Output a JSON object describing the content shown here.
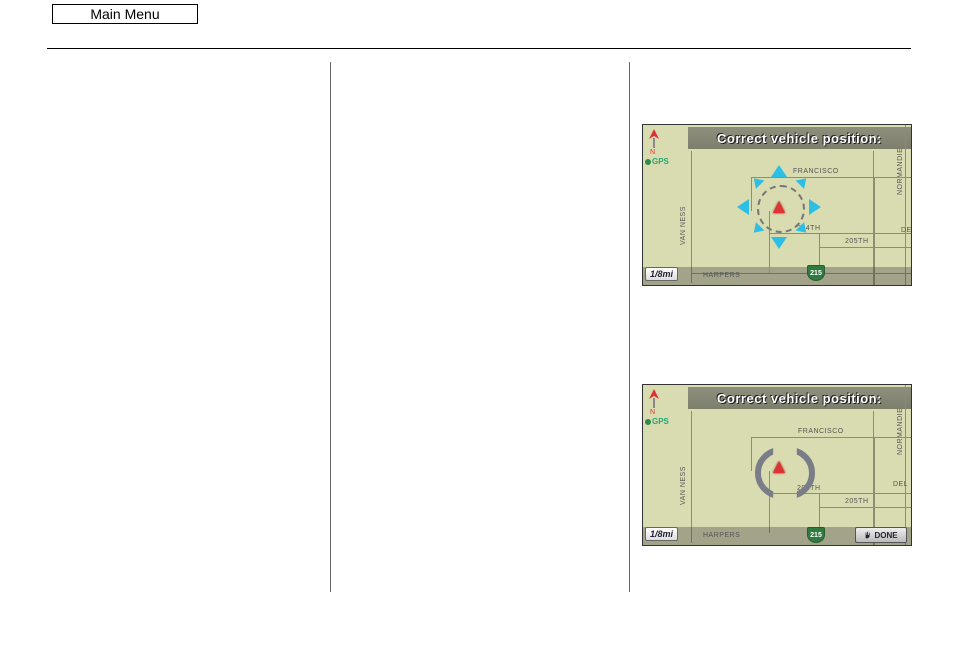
{
  "header": {
    "main_menu_label": "Main Menu"
  },
  "map_scale": "1/8mi",
  "gps_label": "GPS",
  "roads": {
    "van_ness": "VAN  NESS",
    "harpers": "HARPERS",
    "francisco": "FRANCISCO",
    "st204": "204TH",
    "st205": "205TH",
    "normandie": "NORMANDIE",
    "del": "DEL"
  },
  "shield_215": "215",
  "panel1": {
    "title": "Correct vehicle position:"
  },
  "panel2": {
    "title": "Correct vehicle position:",
    "done_label": "DONE"
  }
}
